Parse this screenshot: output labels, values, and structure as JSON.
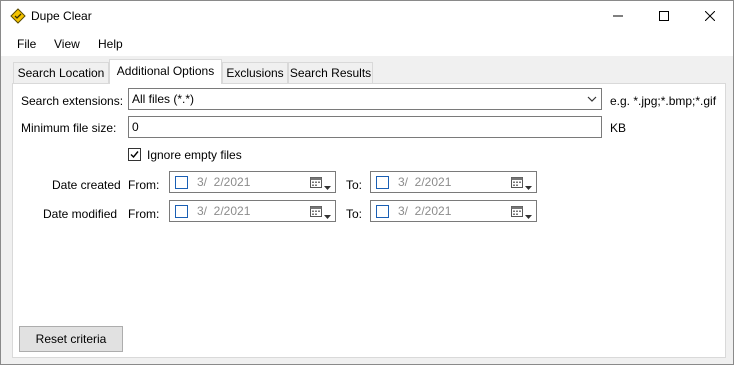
{
  "window": {
    "title": "Dupe Clear",
    "icon": "diamond-app-icon",
    "controls": [
      "minimize-icon",
      "maximize-icon",
      "close-icon"
    ]
  },
  "menu": {
    "file": "File",
    "view": "View",
    "help": "Help"
  },
  "tabs": {
    "search_location": "Search Location",
    "additional_options": "Additional Options",
    "exclusions": "Exclusions",
    "search_results": "Search Results",
    "active": "Additional Options"
  },
  "options": {
    "extensions_label": "Search extensions:",
    "extensions_value": "All files (*.*)",
    "extensions_hint": "e.g. *.jpg;*.bmp;*.gif",
    "min_size_label": "Minimum file size:",
    "min_size_value": "0",
    "min_size_unit": "KB",
    "ignore_empty_label": "Ignore empty files",
    "ignore_empty_checked": true,
    "date_created_label": "Date created",
    "date_modified_label": "Date modified",
    "from_label": "From:",
    "to_label": "To:",
    "created_from": "3/  2/2021",
    "created_to": "3/  2/2021",
    "modified_from": "3/  2/2021",
    "modified_to": "3/  2/2021"
  },
  "buttons": {
    "reset": "Reset criteria"
  },
  "colors": {
    "panel_bg": "#ffffff",
    "window_bg": "#f0f0f0",
    "checkbox_border": "#1a5fb4",
    "disabled_text": "#8c8c8c"
  }
}
